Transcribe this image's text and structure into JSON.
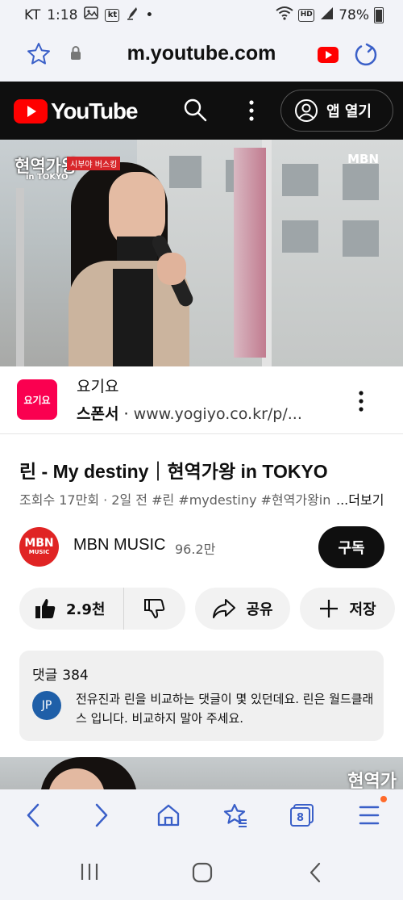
{
  "status": {
    "carrier": "KT",
    "time": "1:18",
    "kt_badge": "kt",
    "dot": "•",
    "hd": "HD",
    "battery": "78%"
  },
  "browser": {
    "url": "m.youtube.com",
    "tab_count": "8"
  },
  "youtube": {
    "logo_text": "YouTube",
    "open_app_label": "앱 열기"
  },
  "video": {
    "overlay_logo": "현역가왕",
    "overlay_sub": "in TOKYO",
    "overlay_tag": "시부야 버스킹",
    "broadcaster": "MBN"
  },
  "ad": {
    "logo_text": "요기요",
    "title": "요기요",
    "sponsor_label": "스폰서",
    "separator": "·",
    "url": "www.yogiyo.co.kr/p/..."
  },
  "info": {
    "title": "린 - My destiny｜현역가왕 in TOKYO",
    "meta": "조회수 17만회 · 2일 전  #린 #mydestiny #현역가왕in",
    "more": "...더보기"
  },
  "channel": {
    "avatar_top": "MBN",
    "avatar_bottom": "MUSIC",
    "name": "MBN MUSIC",
    "subscribers": "96.2만",
    "subscribe_label": "구독"
  },
  "actions": {
    "likes": "2.9천",
    "share_label": "공유",
    "save_label": "저장"
  },
  "comments": {
    "label": "댓글",
    "count": "384",
    "top_author_initials": "JP",
    "top_text": "전유진과 린을 비교하는 댓글이 몇 있던데요. 린은 월드클래스 입니다. 비교하지 말아 주세요."
  },
  "next_video": {
    "overlay_logo": "현역가"
  },
  "colors": {
    "youtube_red": "#ff0000",
    "browser_accent": "#3a5fc8",
    "yogiyo_pink": "#fa0050",
    "mbn_red": "#e02424"
  }
}
